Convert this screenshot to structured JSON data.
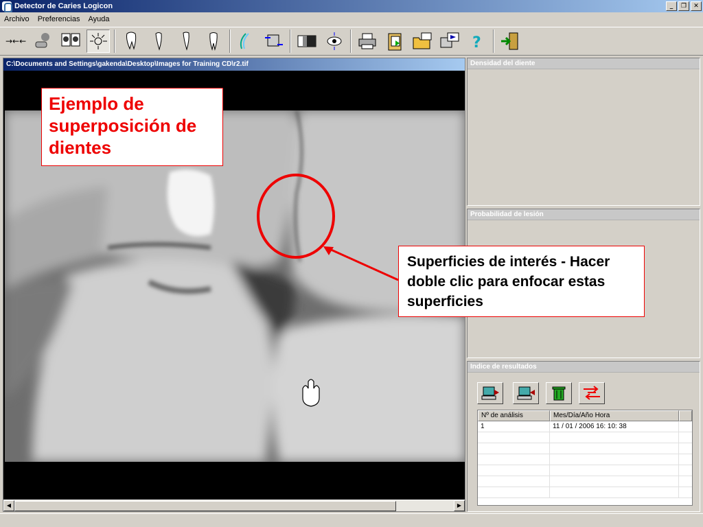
{
  "window": {
    "title": "Detector de Caries Logicon"
  },
  "menu": [
    "Archivo",
    "Preferencias",
    "Ayuda"
  ],
  "toolbar": {
    "buttons": [
      "arrows-icon",
      "patient-icon",
      "compare-icon",
      "light-icon",
      "tooth-1-icon",
      "tooth-2-icon",
      "tooth-3-icon",
      "tooth-4-icon",
      "curve-icon",
      "transfer-icon",
      "contrast-icon",
      "eye-icon",
      "printer-icon",
      "clipboard-icon",
      "folder-open-icon",
      "export-icon",
      "help-icon",
      "exit-icon"
    ]
  },
  "image_window": {
    "path": "C:\\Documents and Settings\\gakenda\\Desktop\\Images for Training CD\\r2.tif"
  },
  "panels": {
    "density": "Densidad del diente",
    "probability": "Probabilidad de lesión",
    "results": "Indice de resultados"
  },
  "results_table": {
    "headers": [
      "Nº de análisis",
      "Mes/Día/Año  Hora"
    ],
    "rows": [
      [
        "1",
        "11 / 01 / 2006   16: 10: 38"
      ]
    ]
  },
  "callouts": {
    "overlap": "Ejemplo de superposición de dientes",
    "surfaces": "Superficies de interés - Hacer doble clic para enfocar estas superficies"
  },
  "colors": {
    "accent": "#ff0000",
    "titlebar": "#0a246a"
  }
}
